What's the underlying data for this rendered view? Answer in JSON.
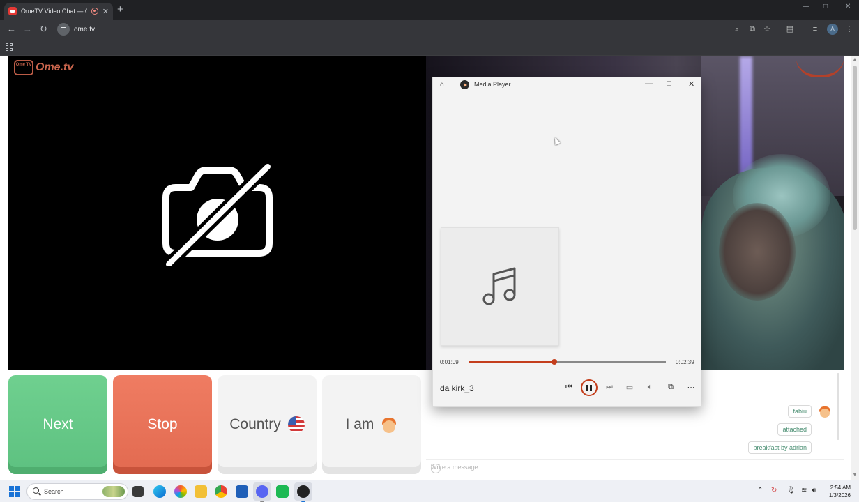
{
  "browser": {
    "tab_title": "OmeTV Video Chat — Ome",
    "tab_close": "✕",
    "new_tab": "+",
    "url": "ome.tv",
    "window_controls": [
      "—",
      "□",
      "✕"
    ]
  },
  "ometv": {
    "logo_badge": "Ome TV",
    "logo_text": "Ome.tv",
    "buttons": {
      "next": "Next",
      "stop": "Stop",
      "country": "Country",
      "iam": "I am"
    },
    "chat": {
      "messages": [
        "fabiu",
        "attached",
        "breakfast by adrian"
      ],
      "input_placeholder": "Write a message"
    }
  },
  "media_player": {
    "title": "Media Player",
    "elapsed": "0:01:09",
    "total": "0:02:39",
    "progress_fraction": 0.434,
    "track_name": "da kirk_3",
    "accent": "#c43e1c"
  },
  "taskbar": {
    "search_label": "Search",
    "time": "2:54 AM",
    "date": "1/3/2026"
  },
  "colors": {
    "next": "#5dc180",
    "stop": "#e26a50",
    "chat_text": "#4b8f73"
  }
}
